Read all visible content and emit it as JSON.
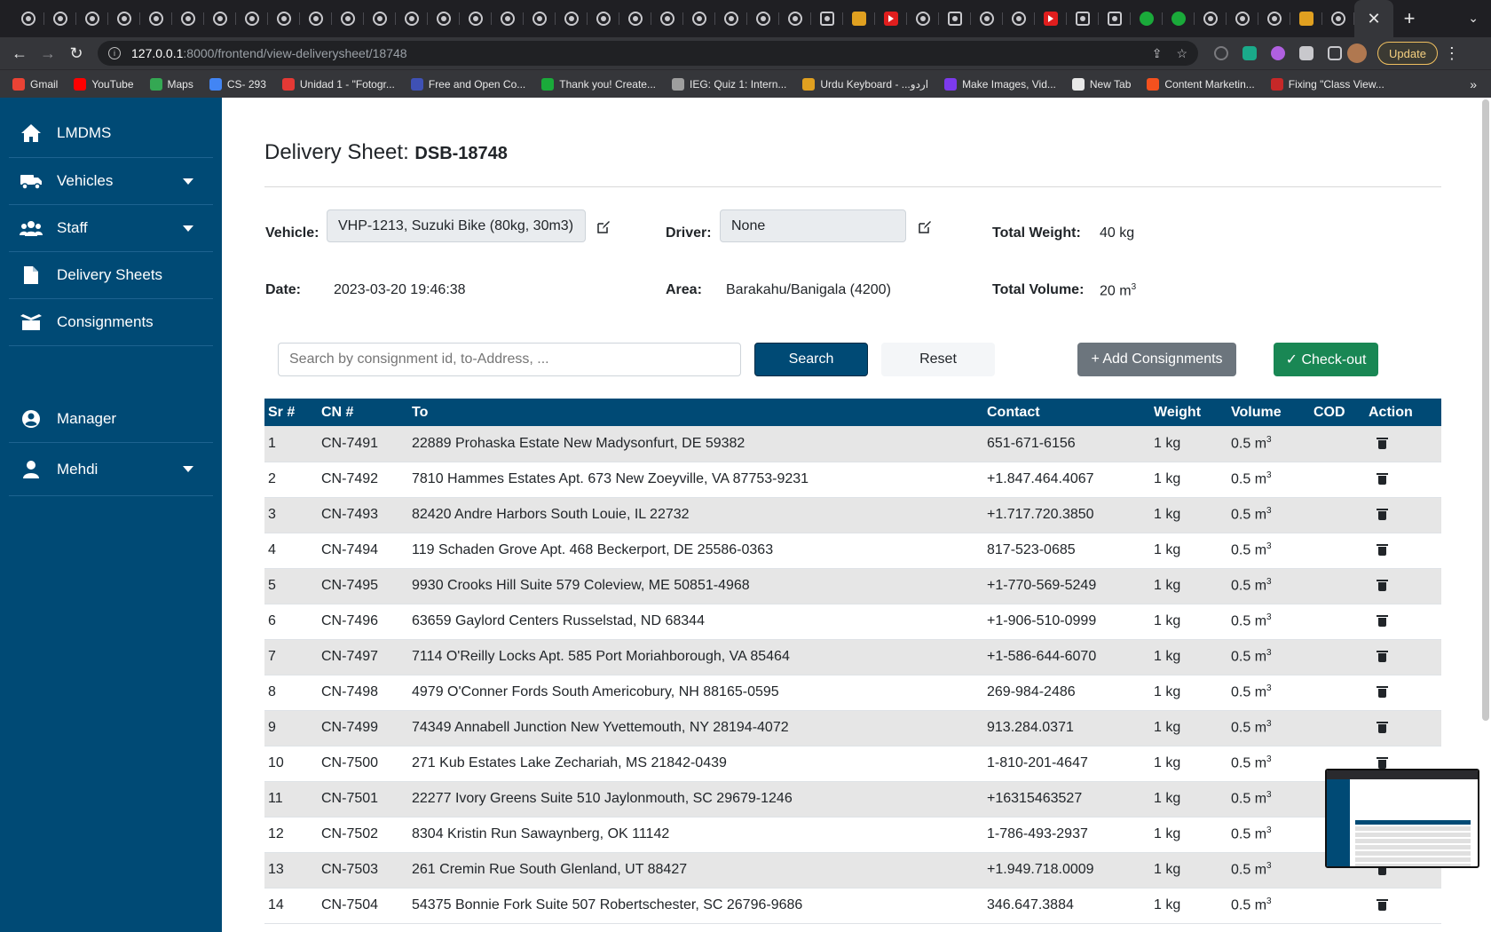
{
  "browser": {
    "url_host": "127.0.0.1",
    "url_path": ":8000/frontend/view-deliverysheet/18748",
    "update_label": "Update",
    "bookmarks": [
      {
        "label": "Gmail",
        "color": "#ea4335"
      },
      {
        "label": "YouTube",
        "color": "#ff0000"
      },
      {
        "label": "Maps",
        "color": "#34a853"
      },
      {
        "label": "CS- 293",
        "color": "#4285f4"
      },
      {
        "label": "Unidad 1 - \"Fotogr...",
        "color": "#e53935"
      },
      {
        "label": "Free and Open Co...",
        "color": "#3f51b5"
      },
      {
        "label": "Thank you! Create...",
        "color": "#1aaa3a"
      },
      {
        "label": "IEG: Quiz 1: Intern...",
        "color": "#9e9e9e"
      },
      {
        "label": "Urdu Keyboard - ...ﺍﺭﺩﻭ",
        "color": "#e0a020"
      },
      {
        "label": "Make Images, Vid...",
        "color": "#7c3aed"
      },
      {
        "label": "New Tab",
        "color": "#e8e8e8"
      },
      {
        "label": "Content Marketin...",
        "color": "#f4511e"
      },
      {
        "label": "Fixing \"Class View...",
        "color": "#c62828"
      }
    ]
  },
  "sidebar": {
    "brand": "LMDMS",
    "items": [
      {
        "label": "Vehicles"
      },
      {
        "label": "Staff"
      },
      {
        "label": "Delivery Sheets"
      },
      {
        "label": "Consignments"
      }
    ],
    "manager": "Manager",
    "user": "Mehdi"
  },
  "sheet": {
    "title_prefix": "Delivery Sheet:",
    "title_id": "DSB-18748",
    "vehicle_label": "Vehicle:",
    "vehicle_value": "VHP-1213, Suzuki Bike (80kg, 30m3)",
    "driver_label": "Driver:",
    "driver_value": "None",
    "total_weight_label": "Total Weight:",
    "total_weight_value": "40 kg",
    "date_label": "Date:",
    "date_value": "2023-03-20 19:46:38",
    "area_label": "Area:",
    "area_value": "Barakahu/Banigala (4200)",
    "total_volume_label": "Total Volume:",
    "total_volume_value": "20 m",
    "total_volume_sup": "3"
  },
  "actions": {
    "search_placeholder": "Search by consignment id, to-Address, ...",
    "search_label": "Search",
    "reset_label": "Reset",
    "add_label": "+ Add Consignments",
    "checkout_label": "✓ Check-out"
  },
  "table": {
    "headers": [
      "Sr #",
      "CN #",
      "To",
      "Contact",
      "Weight",
      "Volume",
      "COD",
      "Action"
    ],
    "rows": [
      {
        "sr": "1",
        "cn": "CN-7491",
        "to": "22889 Prohaska Estate New Madysonfurt, DE 59382",
        "contact": "651-671-6156",
        "weight": "1 kg",
        "volume": "0.5 m",
        "cod": ""
      },
      {
        "sr": "2",
        "cn": "CN-7492",
        "to": "7810 Hammes Estates Apt. 673 New Zoeyville, VA 87753-9231",
        "contact": "+1.847.464.4067",
        "weight": "1 kg",
        "volume": "0.5 m",
        "cod": ""
      },
      {
        "sr": "3",
        "cn": "CN-7493",
        "to": "82420 Andre Harbors South Louie, IL 22732",
        "contact": "+1.717.720.3850",
        "weight": "1 kg",
        "volume": "0.5 m",
        "cod": ""
      },
      {
        "sr": "4",
        "cn": "CN-7494",
        "to": "119 Schaden Grove Apt. 468 Beckerport, DE 25586-0363",
        "contact": "817-523-0685",
        "weight": "1 kg",
        "volume": "0.5 m",
        "cod": ""
      },
      {
        "sr": "5",
        "cn": "CN-7495",
        "to": "9930 Crooks Hill Suite 579 Coleview, ME 50851-4968",
        "contact": "+1-770-569-5249",
        "weight": "1 kg",
        "volume": "0.5 m",
        "cod": ""
      },
      {
        "sr": "6",
        "cn": "CN-7496",
        "to": "63659 Gaylord Centers Russelstad, ND 68344",
        "contact": "+1-906-510-0999",
        "weight": "1 kg",
        "volume": "0.5 m",
        "cod": ""
      },
      {
        "sr": "7",
        "cn": "CN-7497",
        "to": "7114 O'Reilly Locks Apt. 585 Port Moriahborough, VA 85464",
        "contact": "+1-586-644-6070",
        "weight": "1 kg",
        "volume": "0.5 m",
        "cod": ""
      },
      {
        "sr": "8",
        "cn": "CN-7498",
        "to": "4979 O'Conner Fords South Americobury, NH 88165-0595",
        "contact": "269-984-2486",
        "weight": "1 kg",
        "volume": "0.5 m",
        "cod": ""
      },
      {
        "sr": "9",
        "cn": "CN-7499",
        "to": "74349 Annabell Junction New Yvettemouth, NY 28194-4072",
        "contact": "913.284.0371",
        "weight": "1 kg",
        "volume": "0.5 m",
        "cod": ""
      },
      {
        "sr": "10",
        "cn": "CN-7500",
        "to": "271 Kub Estates Lake Zechariah, MS 21842-0439",
        "contact": "1-810-201-4647",
        "weight": "1 kg",
        "volume": "0.5 m",
        "cod": ""
      },
      {
        "sr": "11",
        "cn": "CN-7501",
        "to": "22277 Ivory Greens Suite 510 Jaylonmouth, SC 29679-1246",
        "contact": "+16315463527",
        "weight": "1 kg",
        "volume": "0.5 m",
        "cod": ""
      },
      {
        "sr": "12",
        "cn": "CN-7502",
        "to": "8304 Kristin Run Sawaynberg, OK 11142",
        "contact": "1-786-493-2937",
        "weight": "1 kg",
        "volume": "0.5 m",
        "cod": ""
      },
      {
        "sr": "13",
        "cn": "CN-7503",
        "to": "261 Cremin Rue South Glenland, UT 88427",
        "contact": "+1.949.718.0009",
        "weight": "1 kg",
        "volume": "0.5 m",
        "cod": ""
      },
      {
        "sr": "14",
        "cn": "CN-7504",
        "to": "54375 Bonnie Fork Suite 507 Robertschester, SC 26796-9686",
        "contact": "346.647.3884",
        "weight": "1 kg",
        "volume": "0.5 m",
        "cod": ""
      }
    ],
    "volume_sup": "3"
  },
  "colors": {
    "primary": "#004a75",
    "success": "#198754",
    "secondary": "#6c757d"
  }
}
